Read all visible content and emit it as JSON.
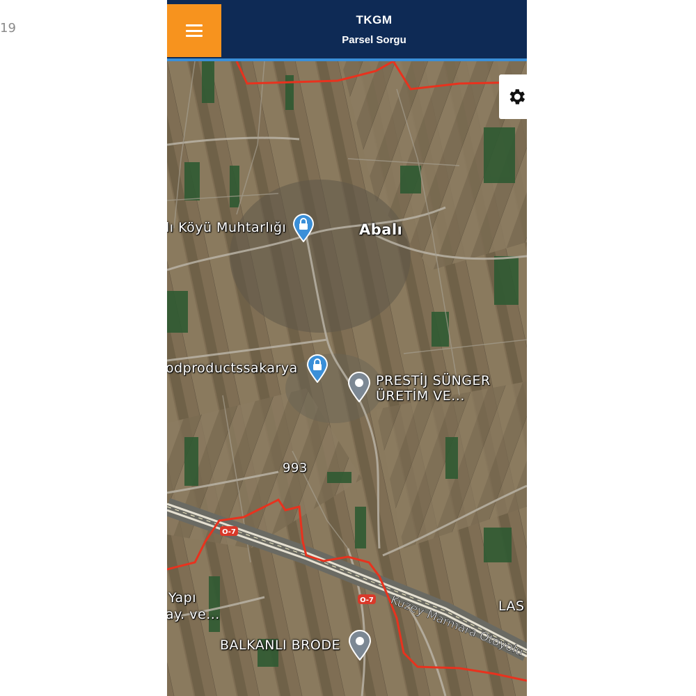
{
  "stray_text": "19",
  "header": {
    "title": "TKGM",
    "subtitle": "Parsel Sorgu"
  },
  "icons": {
    "menu": "hamburger-menu-icon",
    "settings": "gear-icon",
    "poi_lock": "lock-pin-icon",
    "poi_pin": "location-pin-icon"
  },
  "colors": {
    "header_bg": "#0e2a55",
    "menu_bg": "#f7931e",
    "accent_line": "#3a8fd8",
    "boundary": "#e8321e",
    "poi_blue": "#3a8fd8"
  },
  "map": {
    "labels": {
      "muhtarlik": "lı Köyü Muhtarlığı",
      "abali": "Abalı",
      "woodproducts": "odproductssakarya",
      "prestij_1": "PRESTİJ SÜNGER",
      "prestij_2": "ÜRETİM VE...",
      "parcel_993": "993",
      "yapi_1": "Yapı",
      "yapi_2": "ay. ve...",
      "balkanli": "BALKANLI BRODE",
      "las": "LAS",
      "motorway": "Kuzey Marmara Otoyolu",
      "road_shield": "O-7"
    }
  }
}
